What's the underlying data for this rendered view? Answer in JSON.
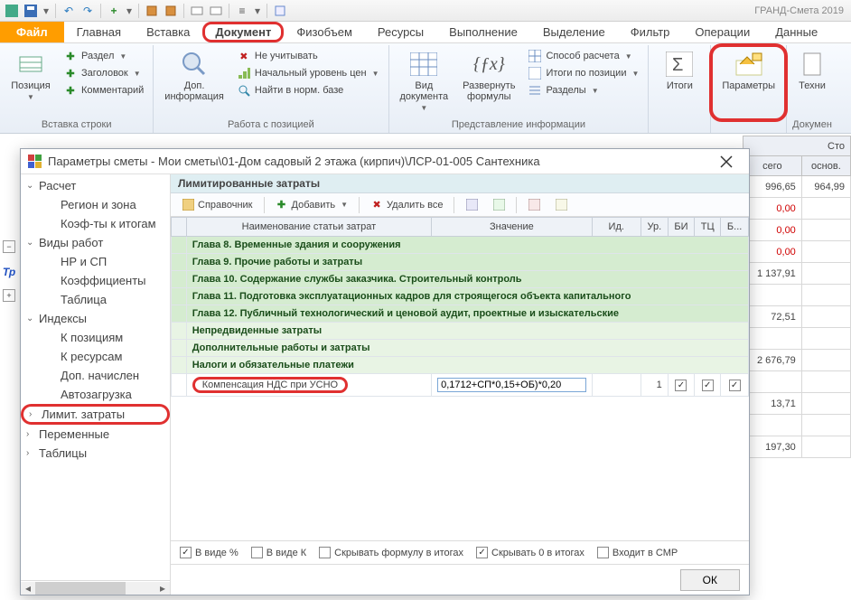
{
  "app_title": "ГРАНД-Смета 2019",
  "qat": {
    "items": [
      "save",
      "undo",
      "redo",
      "refresh",
      "layout",
      "print",
      "cols",
      "table",
      "export"
    ]
  },
  "tabs": {
    "file": "Файл",
    "items": [
      "Главная",
      "Вставка",
      "Документ",
      "Физобъем",
      "Ресурсы",
      "Выполнение",
      "Выделение",
      "Фильтр",
      "Операции",
      "Данные"
    ],
    "highlight_index": 2
  },
  "ribbon": {
    "g1": {
      "big": "Позиция",
      "items": [
        {
          "ico": "+",
          "txt": "Раздел",
          "drop": true
        },
        {
          "ico": "+",
          "txt": "Заголовок",
          "drop": true
        },
        {
          "ico": "+",
          "txt": "Комментарий"
        }
      ],
      "title": "Вставка строки"
    },
    "g2": {
      "big": "Доп.\nинформация",
      "title": "Работа с позицией",
      "items": [
        {
          "ico": "✖",
          "txt": "Не учитывать"
        },
        {
          "ico": "lvl",
          "txt": "Начальный уровень цен",
          "drop": true
        },
        {
          "ico": "🔍",
          "txt": "Найти в норм. базе"
        }
      ]
    },
    "g3": {
      "big1": "Вид\nдокумента",
      "big2": "Развернуть\nформулы",
      "title": "Представление информации",
      "items": [
        {
          "ico": "calc",
          "txt": "Способ расчета",
          "drop": true
        },
        {
          "ico": "sum",
          "txt": "Итоги по позиции",
          "drop": true
        },
        {
          "ico": "sec",
          "txt": "Разделы",
          "drop": true
        }
      ]
    },
    "g4": {
      "big": "Итоги"
    },
    "g5": {
      "big": "Параметры"
    },
    "g6": {
      "big": "Техни",
      "title": "Докумен"
    }
  },
  "bg_grid": {
    "head1": "Сто",
    "head2": "сего",
    "head3": "основ.",
    "rows": [
      {
        "a": "996,65",
        "b": "964,99"
      },
      {
        "a": "0,00",
        "b": "",
        "neg": true
      },
      {
        "a": "0,00",
        "b": "",
        "neg": true
      },
      {
        "a": "0,00",
        "b": "",
        "neg": true
      },
      {
        "a": "1 137,91",
        "b": ""
      },
      {
        "a": "",
        "b": ""
      },
      {
        "a": "72,51",
        "b": ""
      },
      {
        "a": "",
        "b": ""
      },
      {
        "a": "2 676,79",
        "b": ""
      },
      {
        "a": "",
        "b": ""
      },
      {
        "a": "13,71",
        "b": ""
      },
      {
        "a": "",
        "b": ""
      },
      {
        "a": "197,30",
        "b": ""
      }
    ]
  },
  "dialog": {
    "title": "Параметры сметы - Мои сметы\\01-Дом садовый 2 этажа (кирпич)\\ЛСР-01-005 Сантехника",
    "tree": {
      "items": [
        {
          "txt": "Расчет",
          "lvl": 0,
          "exp": true
        },
        {
          "txt": "Регион и зона",
          "lvl": 1
        },
        {
          "txt": "Коэф-ты к итогам",
          "lvl": 1
        },
        {
          "txt": "Виды работ",
          "lvl": 0,
          "exp": true
        },
        {
          "txt": "НР и СП",
          "lvl": 1
        },
        {
          "txt": "Коэффициенты",
          "lvl": 1
        },
        {
          "txt": "Таблица",
          "lvl": 1
        },
        {
          "txt": "Индексы",
          "lvl": 0,
          "exp": true
        },
        {
          "txt": "К позициям",
          "lvl": 1
        },
        {
          "txt": "К ресурсам",
          "lvl": 1
        },
        {
          "txt": "Доп. начислен",
          "lvl": 1
        },
        {
          "txt": "Автозагрузка",
          "lvl": 1
        },
        {
          "txt": "Лимит. затраты",
          "lvl": 0,
          "hl": true
        },
        {
          "txt": "Переменные",
          "lvl": 0
        },
        {
          "txt": "Таблицы",
          "lvl": 0
        }
      ]
    },
    "pane_title": "Лимитированные затраты",
    "toolbar": {
      "ref": "Справочник",
      "add": "Добавить",
      "del": "Удалить все"
    },
    "columns": {
      "c1": "Наименование статьи затрат",
      "c2": "Значение",
      "c3": "Ид.",
      "c4": "Ур.",
      "c5": "БИ",
      "c6": "ТЦ",
      "c7": "Б..."
    },
    "rows": [
      {
        "t": "chapter",
        "txt": "Глава 8. Временные здания и сооружения"
      },
      {
        "t": "chapter",
        "txt": "Глава 9. Прочие работы и затраты"
      },
      {
        "t": "chapter",
        "txt": "Глава 10. Содержание службы заказчика. Строительный контроль"
      },
      {
        "t": "chapter",
        "txt": "Глава 11. Подготовка эксплуатационных кадров для строящегося объекта капитального"
      },
      {
        "t": "chapter",
        "txt": "Глава 12. Публичный технологический и ценовой аудит, проектные и изыскательские"
      },
      {
        "t": "sub",
        "txt": "Непредвиденные затраты"
      },
      {
        "t": "sub",
        "txt": "Дополнительные работы и затраты"
      },
      {
        "t": "sub",
        "txt": "Налоги и обязательные платежи"
      },
      {
        "t": "formula",
        "name": "Компенсация НДС при УСНО",
        "val": "0,1712+СП*0,15+ОБ)*0,20",
        "ur": "1"
      }
    ],
    "footer": {
      "a": "В виде %",
      "b": "В виде К",
      "c": "Скрывать формулу в итогах",
      "d": "Скрывать 0 в итогах",
      "e": "Входит в СМР"
    },
    "ok": "ОК"
  }
}
